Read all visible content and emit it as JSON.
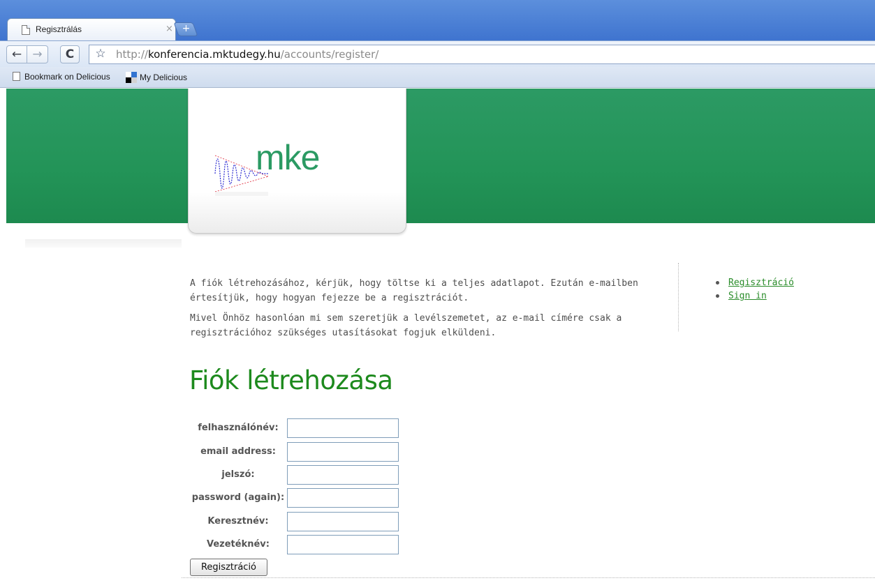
{
  "browser": {
    "tab_title": "Regisztrálás",
    "tab_close": "×",
    "new_tab": "+",
    "back": "←",
    "forward": "→",
    "reload": "C",
    "star": "☆",
    "url_scheme": "http://",
    "url_host": "konferencia.mktudegy.hu",
    "url_path": "/accounts/register/",
    "bookmarks": [
      "Bookmark on Delicious",
      "My Delicious"
    ]
  },
  "header": {
    "logo_text": "mke",
    "brand_color": "#2b9a63",
    "banner_color": "#239458"
  },
  "intro": {
    "paragraph_1": "A fiók létrehozásához, kérjük, hogy töltse ki a teljes adatlapot. Ezután e-mailben értesítjük, hogy hogyan fejezze be a regisztrációt.",
    "paragraph_2": "Mivel Önhöz hasonlóan mi sem szeretjük a levélszemetet, az e-mail címére csak a regisztrációhoz szükséges utasításokat fogjuk elküldeni."
  },
  "sidebar": {
    "links": [
      "Regisztráció",
      "Sign in"
    ]
  },
  "form": {
    "heading": "Fiók létrehozása",
    "fields": [
      {
        "label": "felhasználónév:",
        "value": ""
      },
      {
        "label": "email address:",
        "value": ""
      },
      {
        "label": "jelszó:",
        "value": ""
      },
      {
        "label": "password (again):",
        "value": ""
      },
      {
        "label": "Keresztnév:",
        "value": ""
      },
      {
        "label": "Vezetéknév:",
        "value": ""
      }
    ],
    "submit_label": "Regisztráció"
  }
}
